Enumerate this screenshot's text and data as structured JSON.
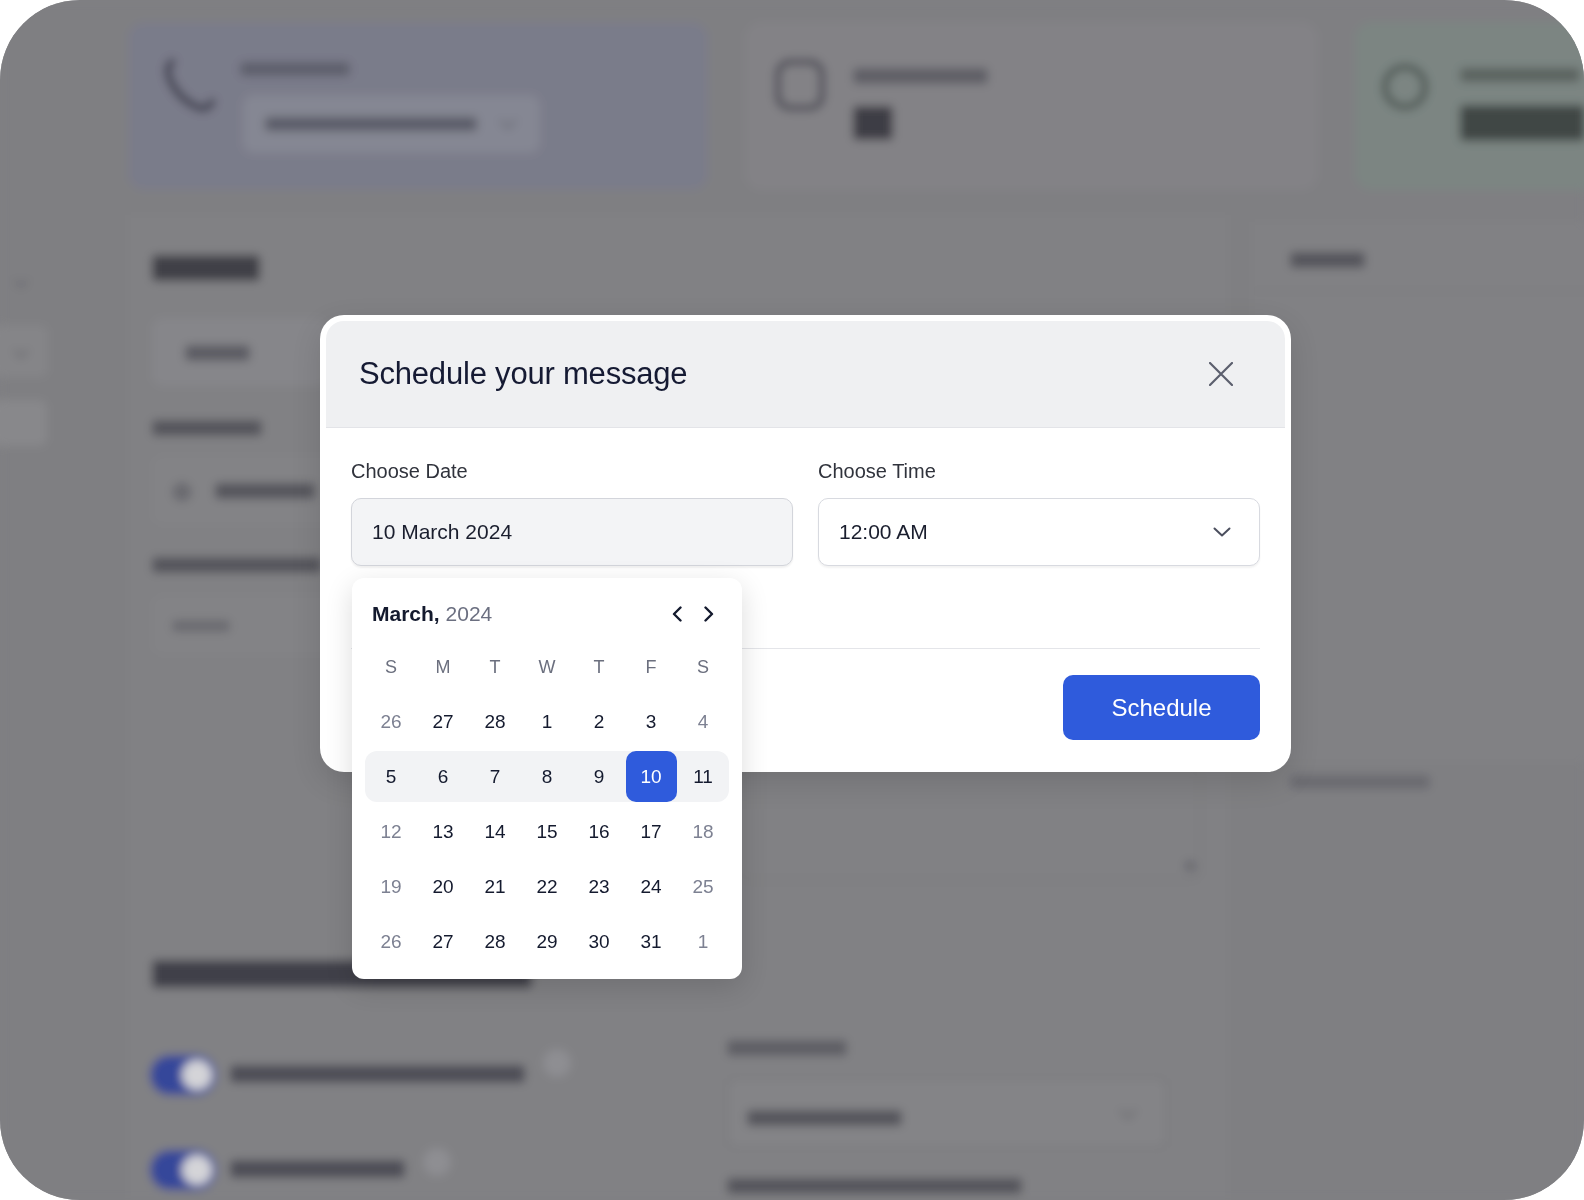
{
  "dialog": {
    "title": "Schedule your message",
    "date_field": {
      "label": "Choose Date",
      "value": "10 March 2024"
    },
    "time_field": {
      "label": "Choose Time",
      "value": "12:00 AM"
    },
    "date_picker": {
      "heading": "**March,** 2024",
      "weekdays": [
        "S",
        "M",
        "T",
        "W",
        "T",
        "F",
        "S"
      ],
      "weeks": [
        {
          "highlighted": false,
          "days": [
            {
              "label": "26",
              "muted": true,
              "selected": false
            },
            {
              "label": "27",
              "muted": false,
              "selected": false
            },
            {
              "label": "28",
              "muted": false,
              "selected": false
            },
            {
              "label": "1",
              "muted": false,
              "selected": false
            },
            {
              "label": "2",
              "muted": false,
              "selected": false
            },
            {
              "label": "3",
              "muted": false,
              "selected": false
            },
            {
              "label": "4",
              "muted": true,
              "selected": false
            }
          ]
        },
        {
          "highlighted": true,
          "days": [
            {
              "label": "5",
              "muted": false,
              "selected": false
            },
            {
              "label": "6",
              "muted": false,
              "selected": false
            },
            {
              "label": "7",
              "muted": false,
              "selected": false
            },
            {
              "label": "8",
              "muted": false,
              "selected": false
            },
            {
              "label": "9",
              "muted": false,
              "selected": false
            },
            {
              "label": "10",
              "muted": false,
              "selected": true
            },
            {
              "label": "11",
              "muted": false,
              "selected": false
            }
          ]
        },
        {
          "highlighted": false,
          "days": [
            {
              "label": "12",
              "muted": true,
              "selected": false
            },
            {
              "label": "13",
              "muted": false,
              "selected": false
            },
            {
              "label": "14",
              "muted": false,
              "selected": false
            },
            {
              "label": "15",
              "muted": false,
              "selected": false
            },
            {
              "label": "16",
              "muted": false,
              "selected": false
            },
            {
              "label": "17",
              "muted": false,
              "selected": false
            },
            {
              "label": "18",
              "muted": true,
              "selected": false
            }
          ]
        },
        {
          "highlighted": false,
          "days": [
            {
              "label": "19",
              "muted": true,
              "selected": false
            },
            {
              "label": "20",
              "muted": false,
              "selected": false
            },
            {
              "label": "21",
              "muted": false,
              "selected": false
            },
            {
              "label": "22",
              "muted": false,
              "selected": false
            },
            {
              "label": "23",
              "muted": false,
              "selected": false
            },
            {
              "label": "24",
              "muted": false,
              "selected": false
            },
            {
              "label": "25",
              "muted": true,
              "selected": false
            }
          ]
        },
        {
          "highlighted": false,
          "days": [
            {
              "label": "26",
              "muted": true,
              "selected": false
            },
            {
              "label": "27",
              "muted": false,
              "selected": false
            },
            {
              "label": "28",
              "muted": false,
              "selected": false
            },
            {
              "label": "29",
              "muted": false,
              "selected": false
            },
            {
              "label": "30",
              "muted": false,
              "selected": false
            },
            {
              "label": "31",
              "muted": false,
              "selected": false
            },
            {
              "label": "1",
              "muted": true,
              "selected": false
            }
          ]
        }
      ]
    },
    "schedule_button": {
      "label": "Schedule"
    }
  }
}
